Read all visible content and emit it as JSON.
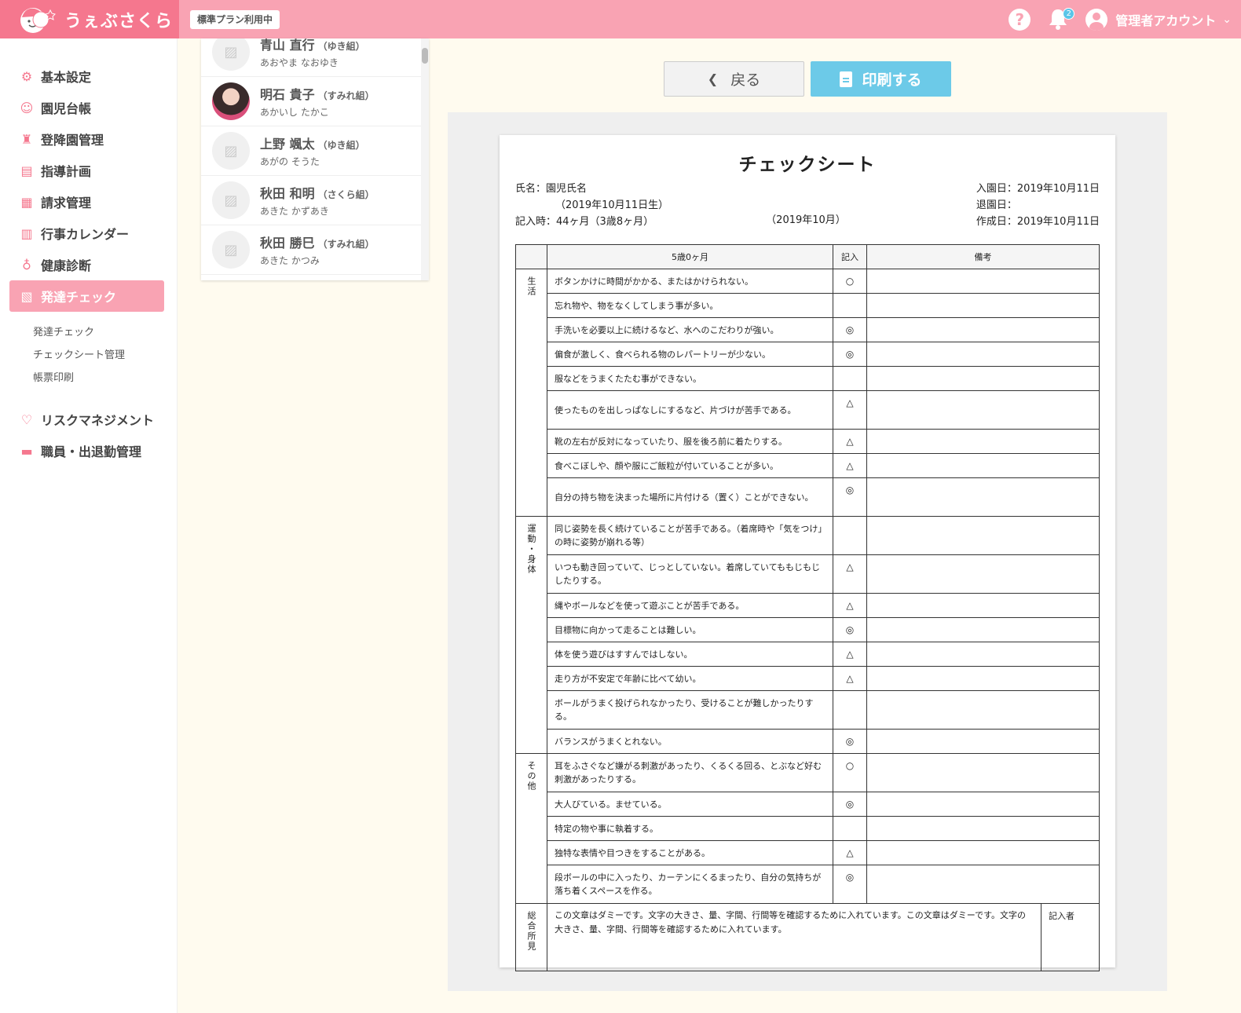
{
  "header": {
    "logo_text": "うぇぶさくら",
    "plan_badge": "標準プラン利用中",
    "help_label": "?",
    "notification_count": "2",
    "user_name": "管理者アカウント"
  },
  "sidebar": {
    "items": [
      {
        "label": "基本設定",
        "icon": "gear-icon"
      },
      {
        "label": "園児台帳",
        "icon": "child-icon"
      },
      {
        "label": "登降園管理",
        "icon": "carousel-icon"
      },
      {
        "label": "指導計画",
        "icon": "notebook-icon"
      },
      {
        "label": "請求管理",
        "icon": "calculator-icon"
      },
      {
        "label": "行事カレンダー",
        "icon": "calendar-icon"
      },
      {
        "label": "健康診断",
        "icon": "stethoscope-icon"
      },
      {
        "label": "発達チェック",
        "icon": "clipboard-icon"
      }
    ],
    "submenu": [
      "発達チェック",
      "チェックシート管理",
      "帳票印刷"
    ],
    "items_after": [
      {
        "label": "リスクマネジメント",
        "icon": "hands-heart-icon"
      },
      {
        "label": "職員・出退勤管理",
        "icon": "briefcase-icon"
      }
    ]
  },
  "children": [
    {
      "name": "青山 直行",
      "class": "（ゆき組）",
      "kana": "あおやま なおゆき",
      "photo": false
    },
    {
      "name": "明石 貴子",
      "class": "（すみれ組）",
      "kana": "あかいし たかこ",
      "photo": true
    },
    {
      "name": "上野 颯太",
      "class": "（ゆき組）",
      "kana": "あがの そうた",
      "photo": false
    },
    {
      "name": "秋田 和明",
      "class": "（さくら組）",
      "kana": "あきた かずあき",
      "photo": false
    },
    {
      "name": "秋田 勝巳",
      "class": "（すみれ組）",
      "kana": "あきた かつみ",
      "photo": false
    }
  ],
  "buttons": {
    "back": "戻る",
    "print": "印刷する"
  },
  "sheet": {
    "title": "チェックシート",
    "name_line": "氏名：園児氏名",
    "birth_line": "（2019年10月11日生）",
    "age_line": "記入時：44ヶ月（3歳8ヶ月）",
    "period": "（2019年10月）",
    "entry_date": "入園日：2019年10月11日",
    "leave_date": "退園日：",
    "created_date": "作成日：2019年10月11日",
    "col_item": "5歳0ヶ月",
    "col_mark": "記入",
    "col_note": "備考",
    "sections": [
      {
        "category": "生活",
        "rows": [
          {
            "text": "ボタンかけに時間がかかる、またはかけられない。",
            "mark": "○"
          },
          {
            "text": "忘れ物や、物をなくしてしまう事が多い。",
            "mark": ""
          },
          {
            "text": "手洗いを必要以上に続けるなど、水へのこだわりが強い。",
            "mark": "◎"
          },
          {
            "text": "偏食が激しく、食べられる物のレパートリーが少ない。",
            "mark": "◎"
          },
          {
            "text": "服などをうまくたたむ事ができない。",
            "mark": ""
          },
          {
            "text": "使ったものを出しっぱなしにするなど、片づけが苦手である。",
            "mark": "△"
          },
          {
            "text": "靴の左右が反対になっていたり、服を後ろ前に着たりする。",
            "mark": "△"
          },
          {
            "text": "食べこぼしや、顔や服にご飯粒が付いていることが多い。",
            "mark": "△"
          },
          {
            "text": "自分の持ち物を決まった場所に片付ける（置く）ことができない。",
            "mark": "◎"
          }
        ]
      },
      {
        "category": "運動・身体",
        "rows": [
          {
            "text": "同じ姿勢を長く続けていることが苦手である。（着席時や「気をつけ」の時に姿勢が崩れる等）",
            "mark": ""
          },
          {
            "text": "いつも動き回っていて、じっとしていない。着席していてももじもじしたりする。",
            "mark": "△"
          },
          {
            "text": "縄やボールなどを使って遊ぶことが苦手である。",
            "mark": "△"
          },
          {
            "text": "目標物に向かって走ることは難しい。",
            "mark": "◎"
          },
          {
            "text": "体を使う遊びはすすんではしない。",
            "mark": "△"
          },
          {
            "text": "走り方が不安定で年齢に比べて幼い。",
            "mark": "△"
          },
          {
            "text": "ボールがうまく投げられなかったり、受けることが難しかったりする。",
            "mark": ""
          },
          {
            "text": "バランスがうまくとれない。",
            "mark": "◎"
          }
        ]
      },
      {
        "category": "その他",
        "rows": [
          {
            "text": "耳をふさぐなど嫌がる刺激があったり、くるくる回る、とぶなど好む刺激があったりする。",
            "mark": "○"
          },
          {
            "text": "大人びている。ませている。",
            "mark": "◎"
          },
          {
            "text": "特定の物や事に執着する。",
            "mark": ""
          },
          {
            "text": "独特な表情や目つきをすることがある。",
            "mark": "△"
          },
          {
            "text": "段ボールの中に入ったり、カーテンにくるまったり、自分の気持ちが落ち着くスペースを作る。",
            "mark": "◎"
          }
        ]
      }
    ],
    "summary_label": "総合所見",
    "summary_text": "この文章はダミーです。文字の大きさ、量、字間、行間等を確認するために入れています。この文章はダミーです。文字の大きさ、量、字間、行間等を確認するために入れています。",
    "writer_label": "記入者"
  }
}
